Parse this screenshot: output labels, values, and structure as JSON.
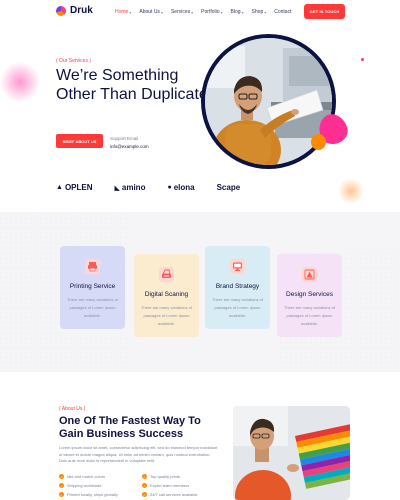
{
  "brand": {
    "name": "Druk"
  },
  "nav": [
    {
      "label": "Home",
      "dropdown": true,
      "active": true
    },
    {
      "label": "About Us",
      "dropdown": true,
      "active": false
    },
    {
      "label": "Services",
      "dropdown": true,
      "active": false
    },
    {
      "label": "Portfolio",
      "dropdown": true,
      "active": false
    },
    {
      "label": "Blog",
      "dropdown": true,
      "active": false
    },
    {
      "label": "Shop",
      "dropdown": true,
      "active": false
    },
    {
      "label": "Contact",
      "dropdown": false,
      "active": false
    }
  ],
  "header_cta": "GET IN TOUCH",
  "hero": {
    "eyebrow": "( Our Services )",
    "title": "We’re Something Other Than Duplicates",
    "button": "BRIEF ABOUT US",
    "support_label": "Support Email",
    "support_email": "info@example.com"
  },
  "brands": [
    "OPLEN",
    "amino",
    "elona",
    "Scape"
  ],
  "services": [
    {
      "title": "Printing Service",
      "text": "There are many variations of passages of Lorem Ipsum available.",
      "bg": "#d6daf7",
      "icon_bg": "#ffd7d0",
      "icon": "printer-icon"
    },
    {
      "title": "Digital Scaning",
      "text": "There are many variations of passages of Lorem Ipsum available.",
      "bg": "#fbeccf",
      "icon_bg": "#ffd7d0",
      "icon": "scanner-icon"
    },
    {
      "title": "Brand Strategy",
      "text": "There are many variations of passages of Lorem Ipsum available.",
      "bg": "#d8ecf5",
      "icon_bg": "#ffd7d0",
      "icon": "monitor-icon"
    },
    {
      "title": "Design Services",
      "text": "There are many variations of passages of Lorem Ipsum available.",
      "bg": "#f6e2f6",
      "icon_bg": "#ffd7d0",
      "icon": "design-icon"
    }
  ],
  "about": {
    "eyebrow": "( About Us )",
    "title": "One Of The Fastest Way To Gain Business Success",
    "text": "Lorem ipsum dolor sit amet, consectetur adipiscing elit, sed do eiusmod tempor incididunt ut labore et dolore magna aliqua. Ut enim ad minim veniam, quis nostrud exercitation. Duis aute irure dolor in reprehenderit in voluptate velit.",
    "features": [
      "Idle and match colors",
      "Top quality prints",
      "Shipping worldwide",
      "Expert team members",
      "Printed locally, ships globally",
      "24/7 call services available"
    ]
  },
  "colors": {
    "accent": "#ff3838",
    "navy": "#0d1340",
    "pink": "#ff2e93",
    "orange": "#ff8a00"
  }
}
